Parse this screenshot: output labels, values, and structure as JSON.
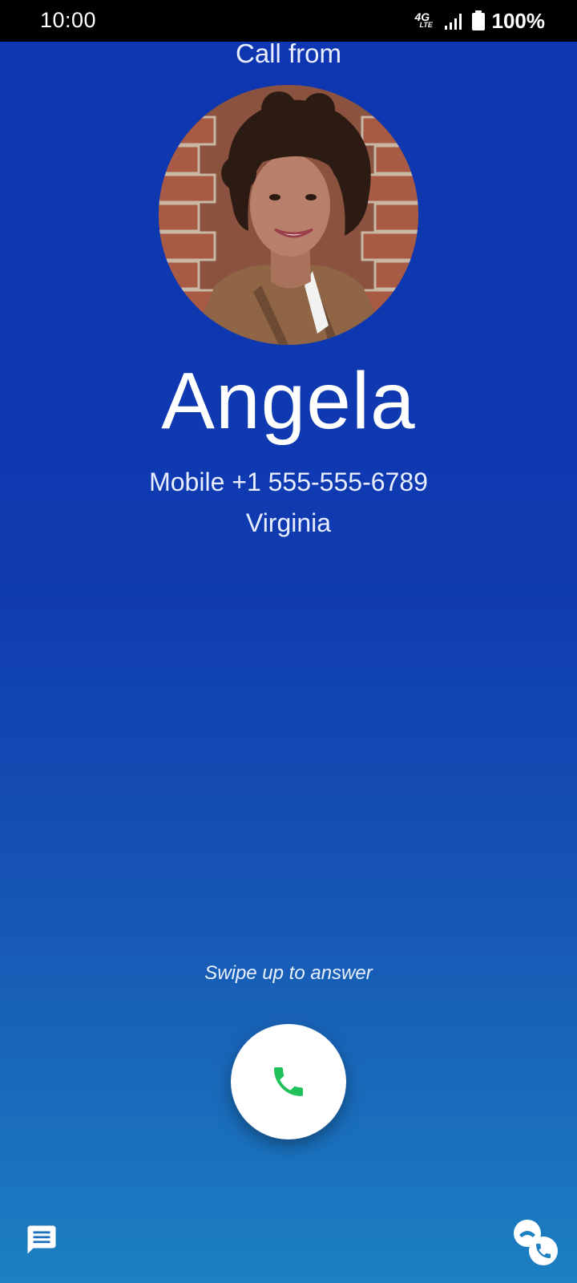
{
  "status_bar": {
    "time": "10:00",
    "network_main": "4G",
    "network_sub": "LTE",
    "battery": "100%",
    "icons": [
      "4g-lte-icon",
      "signal-icon",
      "battery-icon"
    ]
  },
  "call": {
    "header": "Call from",
    "caller_name": "Angela",
    "number_line": "Mobile +1 555-555-6789",
    "location": "Virginia",
    "swipe_hint": "Swipe up to answer"
  },
  "buttons": {
    "answer_icon": "phone-icon",
    "message_icon": "message-icon",
    "secondary_icon": "call-forward-icon"
  },
  "colors": {
    "background_top": "#0d36b0",
    "background_bottom": "#1c80c2",
    "answer_icon": "#1fc25a",
    "status_bar": "#000000"
  }
}
